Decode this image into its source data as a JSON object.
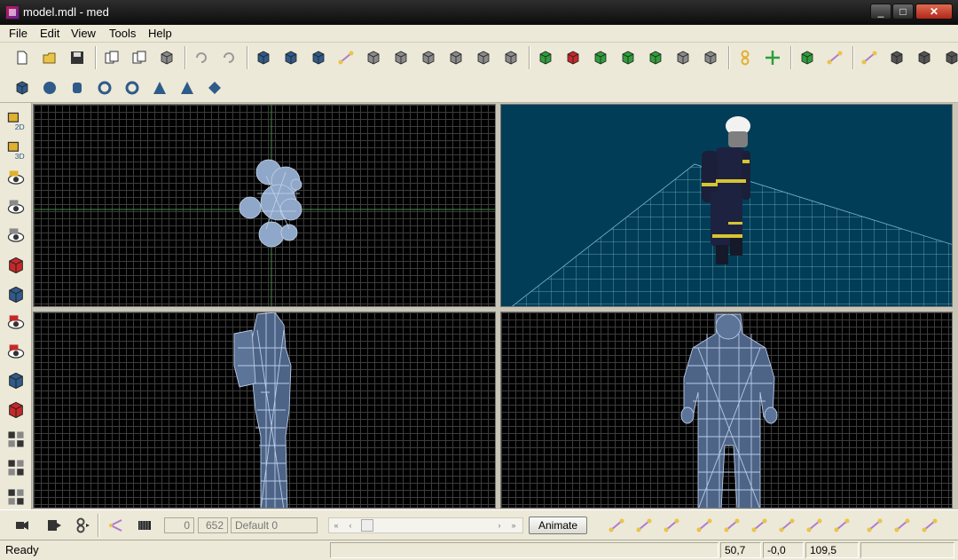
{
  "window": {
    "title": "model.mdl - med",
    "min": "_",
    "max": "□",
    "close": "✕"
  },
  "menu": {
    "items": [
      "File",
      "Edit",
      "View",
      "Tools",
      "Help"
    ]
  },
  "colors": {
    "chrome": "#ece9d8",
    "viewport_bg": "#000000",
    "perspective_bg": "#023d57",
    "wire": "#9fb6d8"
  },
  "toolbar1": {
    "icons": [
      "new-icon",
      "open-icon",
      "save-icon",
      "copy-icon",
      "paste-icon",
      "delete-icon",
      "undo-icon",
      "redo-icon",
      "select-object-icon",
      "select-vertex-icon",
      "select-face-icon",
      "select-bone-icon",
      "translate-icon",
      "rotate-icon",
      "scale-icon",
      "cube-gray-icon",
      "cube-gray-icon",
      "cube-gray-icon",
      "play-icon",
      "cube-red-icon",
      "move-down-icon",
      "rotate-green-icon",
      "move-up-icon",
      "cube-gray-icon",
      "cube-gray-icon",
      "eight-icon",
      "move-axes-icon",
      "add-vertex-icon",
      "add-bone-icon",
      "joint-icon",
      "cube-dark-icon",
      "cube-dark-icon",
      "cube-dark-icon"
    ]
  },
  "toolbar2": {
    "icons": [
      "cube-icon",
      "sphere-icon",
      "cylinder-icon",
      "torus-icon",
      "torus2-icon",
      "cone-icon",
      "pyramid-icon",
      "diamond-icon"
    ]
  },
  "lefttoolbar": {
    "icons": [
      "view-2d-icon",
      "view-3d-icon",
      "eye-yellow-icon",
      "eye-wire-icon",
      "eye-texture-icon",
      "cube-red-icon",
      "cube-blue-icon",
      "eye-red-icon",
      "eye-red2-icon",
      "cube-blue-small-icon",
      "cube-red-small-icon",
      "grid-quad-icon",
      "grid-quad2-icon",
      "grid-quad3-icon"
    ]
  },
  "animation": {
    "frame_start": "0",
    "frame_end": "652",
    "sequence": "Default 0",
    "animate_label": "Animate",
    "rewind": "«",
    "prev": "‹",
    "next": "›",
    "forward": "»"
  },
  "status": {
    "text": "Ready",
    "x": "50,7",
    "y": "-0,0",
    "z": "109,5"
  }
}
